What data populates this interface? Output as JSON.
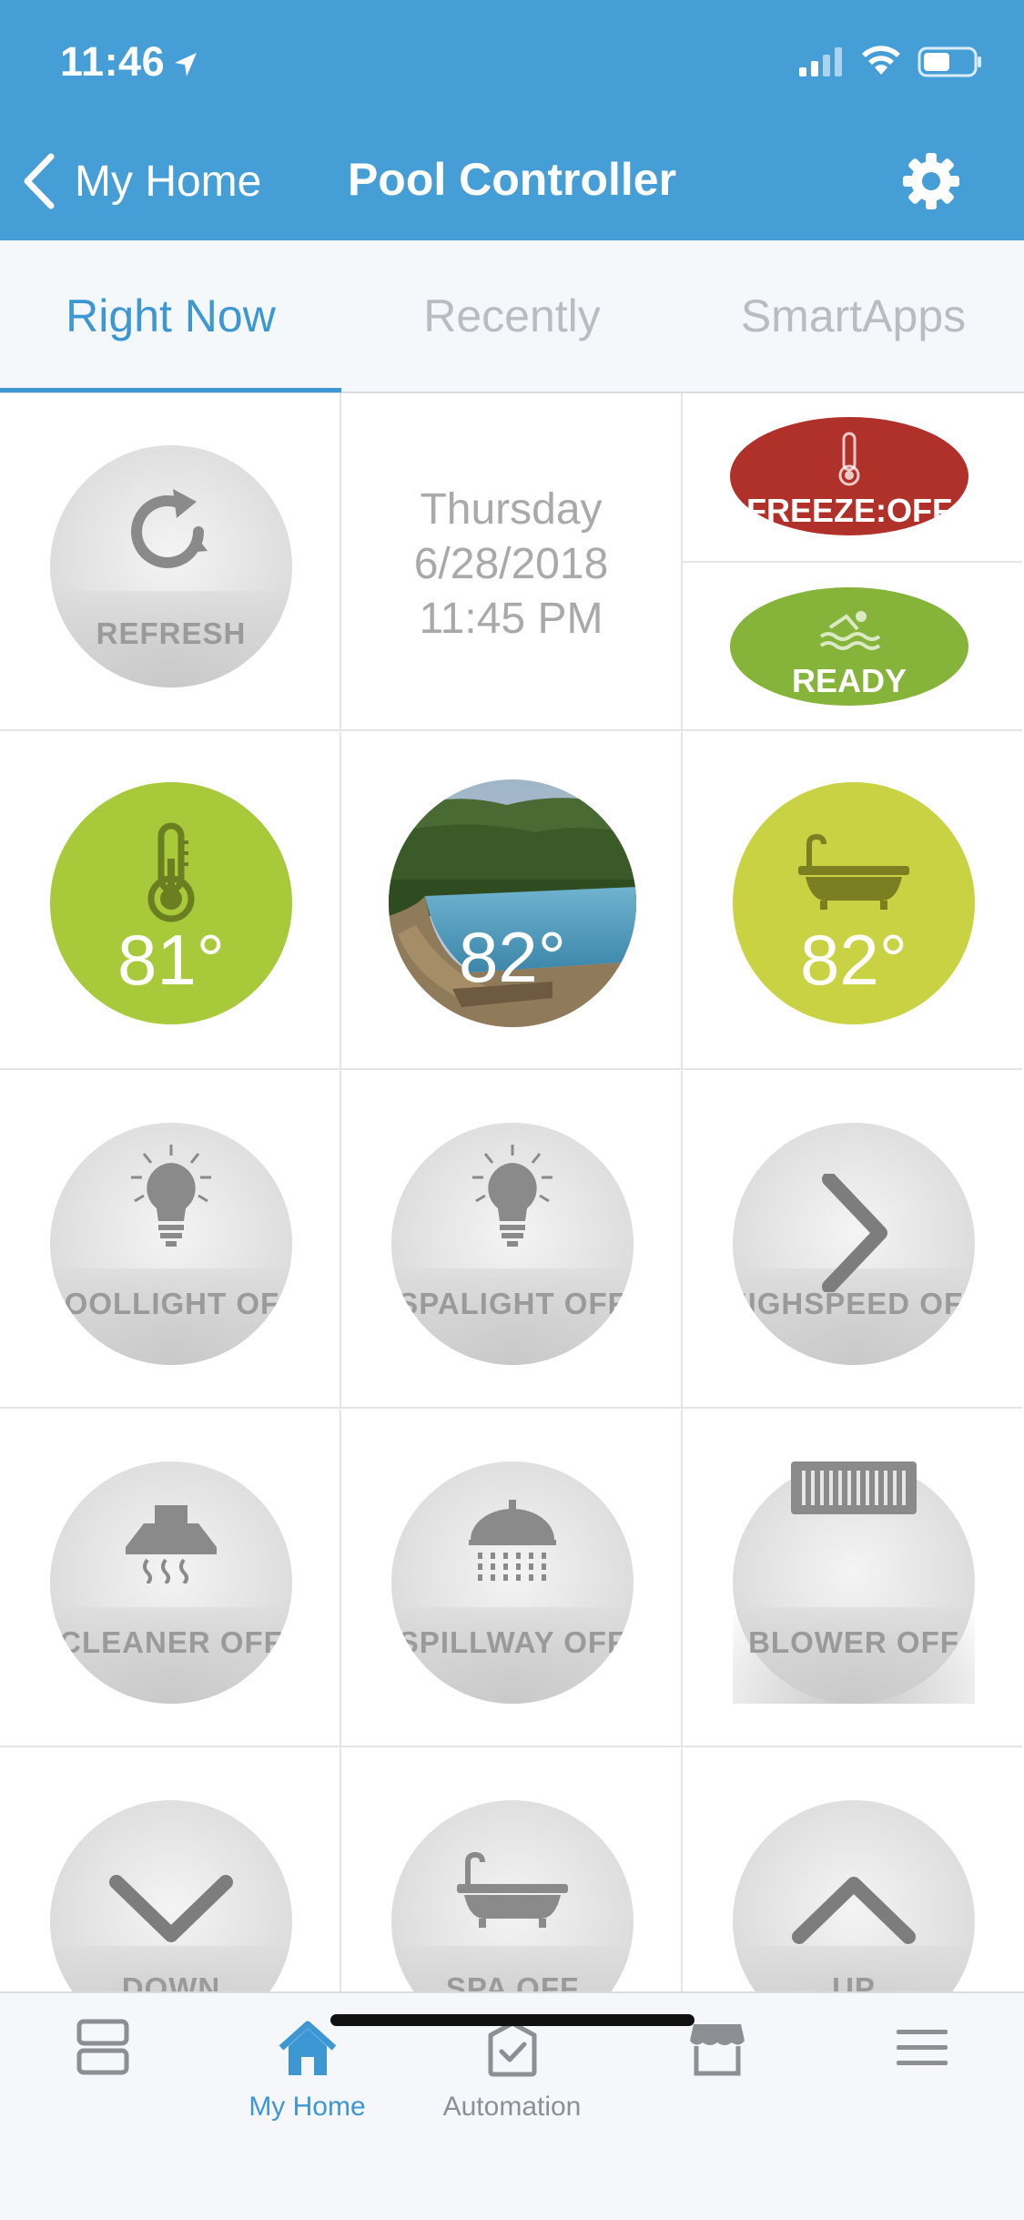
{
  "status_bar": {
    "time": "11:46"
  },
  "nav": {
    "back_label": "My Home",
    "title": "Pool Controller"
  },
  "tabs": [
    {
      "label": "Right Now",
      "active": true
    },
    {
      "label": "Recently",
      "active": false
    },
    {
      "label": "SmartApps",
      "active": false
    }
  ],
  "grid": {
    "refresh": {
      "label": "REFRESH",
      "icon": "refresh-icon"
    },
    "datetime": {
      "day": "Thursday",
      "date": "6/28/2018",
      "time": "11:45 PM"
    },
    "freeze": {
      "label": "FREEZE:OFF",
      "icon": "thermometer-icon",
      "color": "#b0302a"
    },
    "ready": {
      "label": "READY",
      "icon": "swimmer-icon",
      "color": "#86b43a"
    },
    "air_temp": {
      "value": "81°",
      "icon": "thermometer-icon",
      "color": "#a8c93a"
    },
    "pool_temp": {
      "value": "82°",
      "icon": "pool-photo"
    },
    "spa_temp": {
      "value": "82°",
      "icon": "bathtub-icon",
      "color": "#c9d242"
    },
    "poollight": {
      "label": "POOLLIGHT OFF",
      "icon": "lightbulb-icon"
    },
    "spalight": {
      "label": "SPALIGHT OFF",
      "icon": "lightbulb-icon"
    },
    "highspeed": {
      "label": "HIGHSPEED OFF",
      "icon": "chevron-right-icon"
    },
    "cleaner": {
      "label": "CLEANER OFF",
      "icon": "hood-icon"
    },
    "spillway": {
      "label": "SPILLWAY OFF",
      "icon": "shower-icon"
    },
    "blower": {
      "label": "BLOWER OFF",
      "icon": "vent-icon"
    },
    "down": {
      "label": "DOWN",
      "icon": "chevron-down-icon"
    },
    "spa": {
      "label": "SPA OFF",
      "icon": "bathtub-icon"
    },
    "up": {
      "label": "UP",
      "icon": "chevron-up-icon"
    }
  },
  "bottom_bar": [
    {
      "label": "",
      "icon": "dashboard-icon",
      "active": false
    },
    {
      "label": "My Home",
      "icon": "home-icon",
      "active": true
    },
    {
      "label": "Automation",
      "icon": "automation-icon",
      "active": false
    },
    {
      "label": "",
      "icon": "marketplace-icon",
      "active": false
    },
    {
      "label": "",
      "icon": "menu-icon",
      "active": false
    }
  ],
  "colors": {
    "accent": "#459ed6",
    "tab_active": "#3d97d3"
  }
}
